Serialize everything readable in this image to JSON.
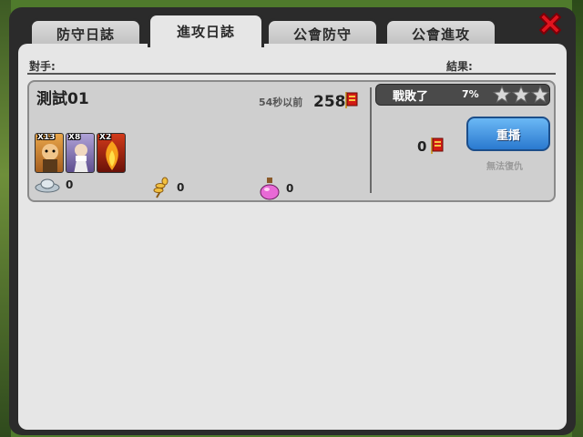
{
  "tabs": [
    {
      "label": "防守日誌",
      "active": false
    },
    {
      "label": "進攻日誌",
      "active": true
    },
    {
      "label": "公會防守",
      "active": false
    },
    {
      "label": "公會進攻",
      "active": false
    }
  ],
  "header": {
    "opponent_label": "對手:",
    "result_label": "結果:"
  },
  "entry": {
    "opponent_name": "測試01",
    "time_ago": "54秒以前",
    "trophies": "258",
    "units": [
      {
        "count": "X13",
        "icon": "warrior-unit-icon"
      },
      {
        "count": "X8",
        "icon": "mage-unit-icon"
      },
      {
        "count": "X2",
        "icon": "fire-dragon-unit-icon"
      }
    ],
    "resources": {
      "silver": "0",
      "wheat": "0",
      "potion": "0"
    },
    "result": {
      "text": "戰敗了",
      "percent": "7%",
      "stars_earned": 0,
      "stars_total": 3
    },
    "trophy_change": "0",
    "replay_label": "重播",
    "revenge_status": "無法復仇"
  },
  "colors": {
    "frame": "#2b2b2b",
    "panel": "#e6e6e6",
    "replay_button": "#3b8fe0",
    "close": "#e0141e"
  }
}
